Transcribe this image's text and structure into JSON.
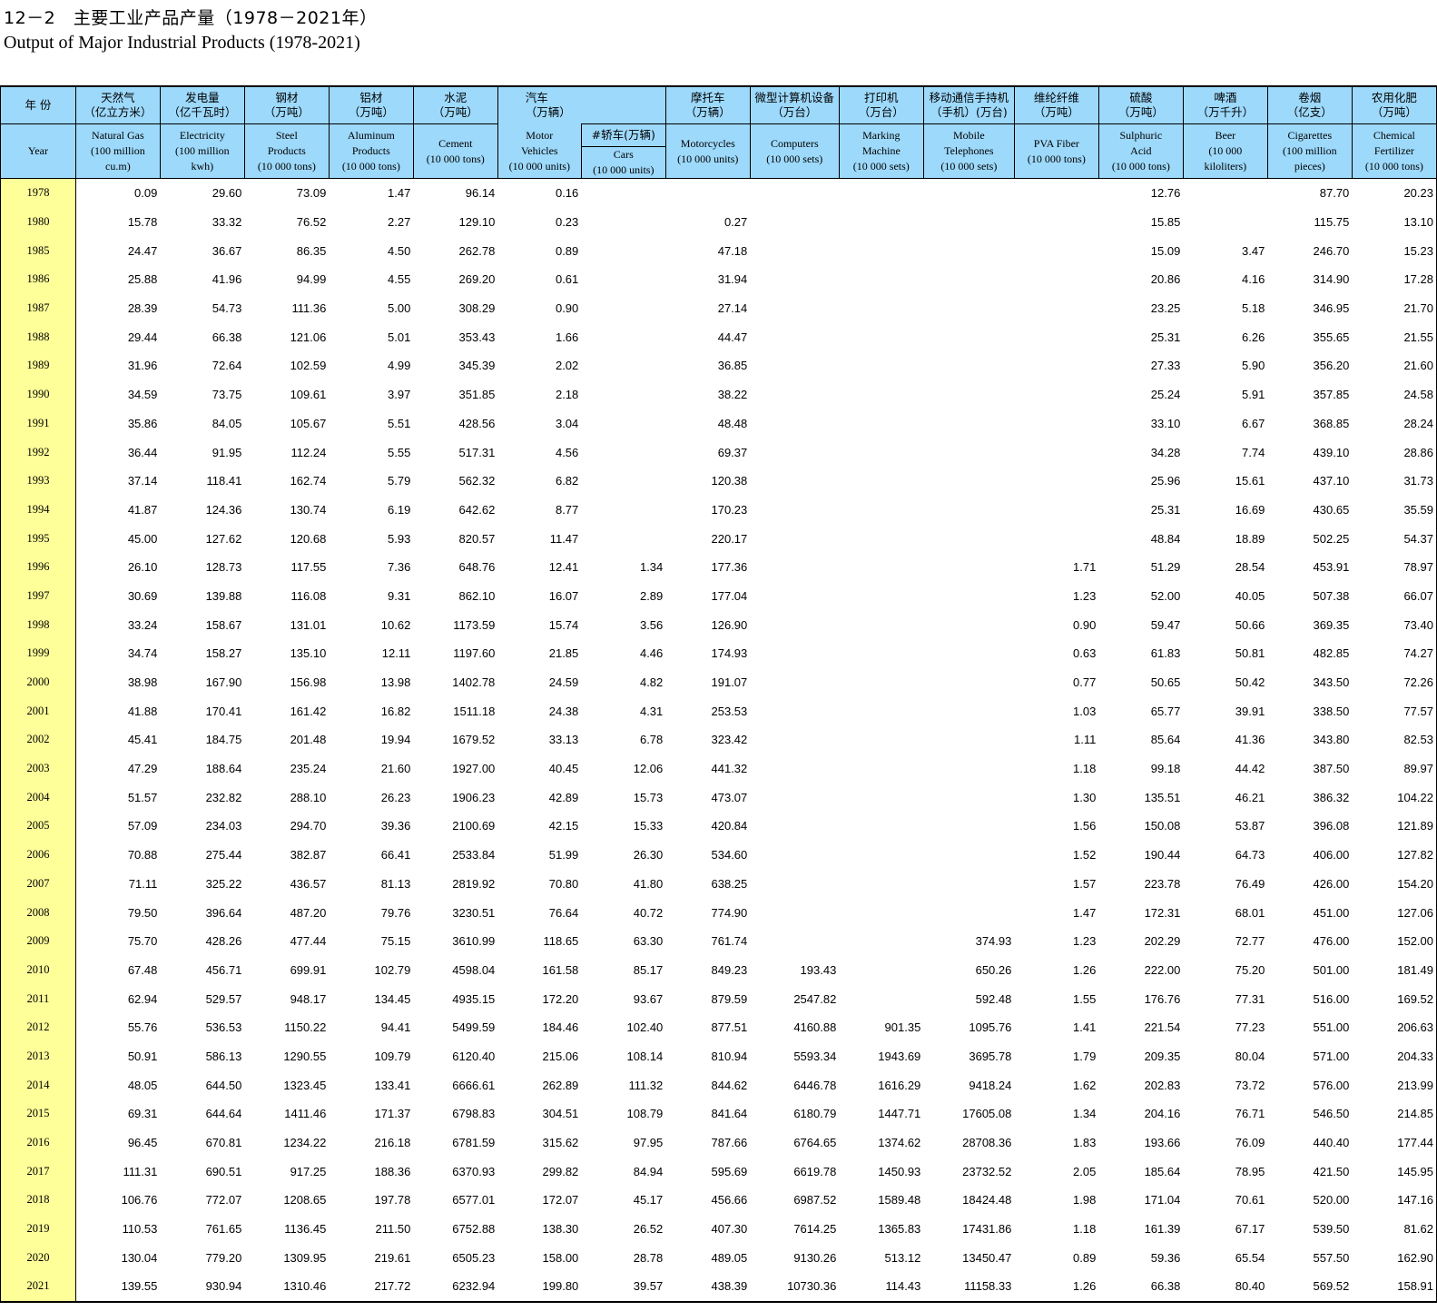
{
  "title": {
    "zh": "12－2　主要工业产品产量（1978－2021年）",
    "en": "Output of Major Industrial Products (1978-2021)"
  },
  "headers": {
    "year": {
      "zh": "年 份",
      "en": "Year"
    },
    "gas": {
      "zh1": "天然气",
      "zh2": "（亿立方米）",
      "en": [
        "Natural Gas",
        "(100 million",
        "cu.m)"
      ]
    },
    "elec": {
      "zh1": "发电量",
      "zh2": "（亿千瓦时）",
      "en": [
        "Electricity",
        "(100 million",
        "kwh)"
      ]
    },
    "steel": {
      "zh1": "钢材",
      "zh2": "（万吨）",
      "en": [
        "Steel",
        "Products",
        "(10 000 tons)"
      ]
    },
    "alum": {
      "zh1": "铝材",
      "zh2": "（万吨）",
      "en": [
        "Aluminum",
        "Products",
        "(10 000 tons)"
      ]
    },
    "cement": {
      "zh1": "水泥",
      "zh2": "（万吨）",
      "en": [
        "Cement",
        "(10 000 tons)"
      ]
    },
    "motor": {
      "zh1": "汽车",
      "zh2": "（万辆）",
      "en": [
        "Motor",
        "Vehicles",
        "(10 000 units)"
      ]
    },
    "cars": {
      "zh": "#轿车(万辆)",
      "en": [
        "Cars",
        "(10 000 units)"
      ]
    },
    "moto": {
      "zh1": "摩托车",
      "zh2": "（万辆）",
      "en": [
        "Motorcycles",
        "(10 000 units)"
      ]
    },
    "comp": {
      "zh1": "微型计算机设备",
      "zh2": "（万台）",
      "en": [
        "Computers",
        "(10 000 sets)"
      ]
    },
    "print": {
      "zh1": "打印机",
      "zh2": "（万台）",
      "en": [
        "Marking",
        "Machine",
        "(10 000 sets)"
      ]
    },
    "mobile": {
      "zh1": "移动通信手持机",
      "zh2": "（手机）(万台)",
      "en": [
        "Mobile",
        "Telephones",
        "(10 000 sets)"
      ]
    },
    "pva": {
      "zh1": "维纶纤维",
      "zh2": "（万吨）",
      "en": [
        "PVA Fiber",
        "(10 000 tons)"
      ]
    },
    "acid": {
      "zh1": "硫酸",
      "zh2": "（万吨）",
      "en": [
        "Sulphuric",
        "Acid",
        "(10 000 tons)"
      ]
    },
    "beer": {
      "zh1": "啤酒",
      "zh2": "（万千升）",
      "en": [
        "Beer",
        "(10 000",
        "kiloliters)"
      ]
    },
    "cig": {
      "zh1": "卷烟",
      "zh2": "（亿支）",
      "en": [
        "Cigarettes",
        "(100 million",
        "pieces)"
      ]
    },
    "fert": {
      "zh1": "农用化肥",
      "zh2": "（万吨）",
      "en": [
        "Chemical",
        "Fertilizer",
        "(10 000 tons)"
      ]
    }
  },
  "rows": [
    [
      "1978",
      "0.09",
      "29.60",
      "73.09",
      "1.47",
      "96.14",
      "0.16",
      "",
      "",
      "",
      "",
      "",
      "",
      "12.76",
      "",
      "87.70",
      "20.23"
    ],
    [
      "1980",
      "15.78",
      "33.32",
      "76.52",
      "2.27",
      "129.10",
      "0.23",
      "",
      "0.27",
      "",
      "",
      "",
      "",
      "15.85",
      "",
      "115.75",
      "13.10"
    ],
    [
      "1985",
      "24.47",
      "36.67",
      "86.35",
      "4.50",
      "262.78",
      "0.89",
      "",
      "47.18",
      "",
      "",
      "",
      "",
      "15.09",
      "3.47",
      "246.70",
      "15.23"
    ],
    [
      "1986",
      "25.88",
      "41.96",
      "94.99",
      "4.55",
      "269.20",
      "0.61",
      "",
      "31.94",
      "",
      "",
      "",
      "",
      "20.86",
      "4.16",
      "314.90",
      "17.28"
    ],
    [
      "1987",
      "28.39",
      "54.73",
      "111.36",
      "5.00",
      "308.29",
      "0.90",
      "",
      "27.14",
      "",
      "",
      "",
      "",
      "23.25",
      "5.18",
      "346.95",
      "21.70"
    ],
    [
      "1988",
      "29.44",
      "66.38",
      "121.06",
      "5.01",
      "353.43",
      "1.66",
      "",
      "44.47",
      "",
      "",
      "",
      "",
      "25.31",
      "6.26",
      "355.65",
      "21.55"
    ],
    [
      "1989",
      "31.96",
      "72.64",
      "102.59",
      "4.99",
      "345.39",
      "2.02",
      "",
      "36.85",
      "",
      "",
      "",
      "",
      "27.33",
      "5.90",
      "356.20",
      "21.60"
    ],
    [
      "1990",
      "34.59",
      "73.75",
      "109.61",
      "3.97",
      "351.85",
      "2.18",
      "",
      "38.22",
      "",
      "",
      "",
      "",
      "25.24",
      "5.91",
      "357.85",
      "24.58"
    ],
    [
      "1991",
      "35.86",
      "84.05",
      "105.67",
      "5.51",
      "428.56",
      "3.04",
      "",
      "48.48",
      "",
      "",
      "",
      "",
      "33.10",
      "6.67",
      "368.85",
      "28.24"
    ],
    [
      "1992",
      "36.44",
      "91.95",
      "112.24",
      "5.55",
      "517.31",
      "4.56",
      "",
      "69.37",
      "",
      "",
      "",
      "",
      "34.28",
      "7.74",
      "439.10",
      "28.86"
    ],
    [
      "1993",
      "37.14",
      "118.41",
      "162.74",
      "5.79",
      "562.32",
      "6.82",
      "",
      "120.38",
      "",
      "",
      "",
      "",
      "25.96",
      "15.61",
      "437.10",
      "31.73"
    ],
    [
      "1994",
      "41.87",
      "124.36",
      "130.74",
      "6.19",
      "642.62",
      "8.77",
      "",
      "170.23",
      "",
      "",
      "",
      "",
      "25.31",
      "16.69",
      "430.65",
      "35.59"
    ],
    [
      "1995",
      "45.00",
      "127.62",
      "120.68",
      "5.93",
      "820.57",
      "11.47",
      "",
      "220.17",
      "",
      "",
      "",
      "",
      "48.84",
      "18.89",
      "502.25",
      "54.37"
    ],
    [
      "1996",
      "26.10",
      "128.73",
      "117.55",
      "7.36",
      "648.76",
      "12.41",
      "1.34",
      "177.36",
      "",
      "",
      "",
      "1.71",
      "51.29",
      "28.54",
      "453.91",
      "78.97"
    ],
    [
      "1997",
      "30.69",
      "139.88",
      "116.08",
      "9.31",
      "862.10",
      "16.07",
      "2.89",
      "177.04",
      "",
      "",
      "",
      "1.23",
      "52.00",
      "40.05",
      "507.38",
      "66.07"
    ],
    [
      "1998",
      "33.24",
      "158.67",
      "131.01",
      "10.62",
      "1173.59",
      "15.74",
      "3.56",
      "126.90",
      "",
      "",
      "",
      "0.90",
      "59.47",
      "50.66",
      "369.35",
      "73.40"
    ],
    [
      "1999",
      "34.74",
      "158.27",
      "135.10",
      "12.11",
      "1197.60",
      "21.85",
      "4.46",
      "174.93",
      "",
      "",
      "",
      "0.63",
      "61.83",
      "50.81",
      "482.85",
      "74.27"
    ],
    [
      "2000",
      "38.98",
      "167.90",
      "156.98",
      "13.98",
      "1402.78",
      "24.59",
      "4.82",
      "191.07",
      "",
      "",
      "",
      "0.77",
      "50.65",
      "50.42",
      "343.50",
      "72.26"
    ],
    [
      "2001",
      "41.88",
      "170.41",
      "161.42",
      "16.82",
      "1511.18",
      "24.38",
      "4.31",
      "253.53",
      "",
      "",
      "",
      "1.03",
      "65.77",
      "39.91",
      "338.50",
      "77.57"
    ],
    [
      "2002",
      "45.41",
      "184.75",
      "201.48",
      "19.94",
      "1679.52",
      "33.13",
      "6.78",
      "323.42",
      "",
      "",
      "",
      "1.11",
      "85.64",
      "41.36",
      "343.80",
      "82.53"
    ],
    [
      "2003",
      "47.29",
      "188.64",
      "235.24",
      "21.60",
      "1927.00",
      "40.45",
      "12.06",
      "441.32",
      "",
      "",
      "",
      "1.18",
      "99.18",
      "44.42",
      "387.50",
      "89.97"
    ],
    [
      "2004",
      "51.57",
      "232.82",
      "288.10",
      "26.23",
      "1906.23",
      "42.89",
      "15.73",
      "473.07",
      "",
      "",
      "",
      "1.30",
      "135.51",
      "46.21",
      "386.32",
      "104.22"
    ],
    [
      "2005",
      "57.09",
      "234.03",
      "294.70",
      "39.36",
      "2100.69",
      "42.15",
      "15.33",
      "420.84",
      "",
      "",
      "",
      "1.56",
      "150.08",
      "53.87",
      "396.08",
      "121.89"
    ],
    [
      "2006",
      "70.88",
      "275.44",
      "382.87",
      "66.41",
      "2533.84",
      "51.99",
      "26.30",
      "534.60",
      "",
      "",
      "",
      "1.52",
      "190.44",
      "64.73",
      "406.00",
      "127.82"
    ],
    [
      "2007",
      "71.11",
      "325.22",
      "436.57",
      "81.13",
      "2819.92",
      "70.80",
      "41.80",
      "638.25",
      "",
      "",
      "",
      "1.57",
      "223.78",
      "76.49",
      "426.00",
      "154.20"
    ],
    [
      "2008",
      "79.50",
      "396.64",
      "487.20",
      "79.76",
      "3230.51",
      "76.64",
      "40.72",
      "774.90",
      "",
      "",
      "",
      "1.47",
      "172.31",
      "68.01",
      "451.00",
      "127.06"
    ],
    [
      "2009",
      "75.70",
      "428.26",
      "477.44",
      "75.15",
      "3610.99",
      "118.65",
      "63.30",
      "761.74",
      "",
      "",
      "374.93",
      "1.23",
      "202.29",
      "72.77",
      "476.00",
      "152.00"
    ],
    [
      "2010",
      "67.48",
      "456.71",
      "699.91",
      "102.79",
      "4598.04",
      "161.58",
      "85.17",
      "849.23",
      "193.43",
      "",
      "650.26",
      "1.26",
      "222.00",
      "75.20",
      "501.00",
      "181.49"
    ],
    [
      "2011",
      "62.94",
      "529.57",
      "948.17",
      "134.45",
      "4935.15",
      "172.20",
      "93.67",
      "879.59",
      "2547.82",
      "",
      "592.48",
      "1.55",
      "176.76",
      "77.31",
      "516.00",
      "169.52"
    ],
    [
      "2012",
      "55.76",
      "536.53",
      "1150.22",
      "94.41",
      "5499.59",
      "184.46",
      "102.40",
      "877.51",
      "4160.88",
      "901.35",
      "1095.76",
      "1.41",
      "221.54",
      "77.23",
      "551.00",
      "206.63"
    ],
    [
      "2013",
      "50.91",
      "586.13",
      "1290.55",
      "109.79",
      "6120.40",
      "215.06",
      "108.14",
      "810.94",
      "5593.34",
      "1943.69",
      "3695.78",
      "1.79",
      "209.35",
      "80.04",
      "571.00",
      "204.33"
    ],
    [
      "2014",
      "48.05",
      "644.50",
      "1323.45",
      "133.41",
      "6666.61",
      "262.89",
      "111.32",
      "844.62",
      "6446.78",
      "1616.29",
      "9418.24",
      "1.62",
      "202.83",
      "73.72",
      "576.00",
      "213.99"
    ],
    [
      "2015",
      "69.31",
      "644.64",
      "1411.46",
      "171.37",
      "6798.83",
      "304.51",
      "108.79",
      "841.64",
      "6180.79",
      "1447.71",
      "17605.08",
      "1.34",
      "204.16",
      "76.71",
      "546.50",
      "214.85"
    ],
    [
      "2016",
      "96.45",
      "670.81",
      "1234.22",
      "216.18",
      "6781.59",
      "315.62",
      "97.95",
      "787.66",
      "6764.65",
      "1374.62",
      "28708.36",
      "1.83",
      "193.66",
      "76.09",
      "440.40",
      "177.44"
    ],
    [
      "2017",
      "111.31",
      "690.51",
      "917.25",
      "188.36",
      "6370.93",
      "299.82",
      "84.94",
      "595.69",
      "6619.78",
      "1450.93",
      "23732.52",
      "2.05",
      "185.64",
      "78.95",
      "421.50",
      "145.95"
    ],
    [
      "2018",
      "106.76",
      "772.07",
      "1208.65",
      "197.78",
      "6577.01",
      "172.07",
      "45.17",
      "456.66",
      "6987.52",
      "1589.48",
      "18424.48",
      "1.98",
      "171.04",
      "70.61",
      "520.00",
      "147.16"
    ],
    [
      "2019",
      "110.53",
      "761.65",
      "1136.45",
      "211.50",
      "6752.88",
      "138.30",
      "26.52",
      "407.30",
      "7614.25",
      "1365.83",
      "17431.86",
      "1.18",
      "161.39",
      "67.17",
      "539.50",
      "81.62"
    ],
    [
      "2020",
      "130.04",
      "779.20",
      "1309.95",
      "219.61",
      "6505.23",
      "158.00",
      "28.78",
      "489.05",
      "9130.26",
      "513.12",
      "13450.47",
      "0.89",
      "59.36",
      "65.54",
      "557.50",
      "162.90"
    ],
    [
      "2021",
      "139.55",
      "930.94",
      "1310.46",
      "217.72",
      "6232.94",
      "199.80",
      "39.57",
      "438.39",
      "10730.36",
      "114.43",
      "11158.33",
      "1.26",
      "66.38",
      "80.40",
      "569.52",
      "158.91"
    ]
  ]
}
